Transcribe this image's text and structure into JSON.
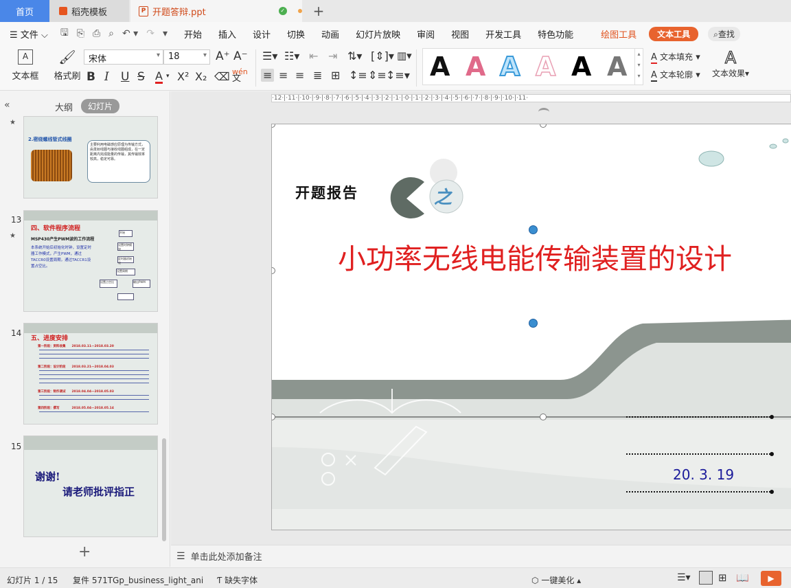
{
  "tabs": {
    "home": "首页",
    "template": "稻壳模板",
    "document": "开题答辩.ppt",
    "add": "+"
  },
  "menu": {
    "file": "文件",
    "items": [
      "开始",
      "插入",
      "设计",
      "切换",
      "动画",
      "幻灯片放映",
      "审阅",
      "视图",
      "开发工具",
      "特色功能"
    ],
    "drawing_tools": "绘图工具",
    "text_tools": "文本工具",
    "search": "查找"
  },
  "ribbon": {
    "textbox": "文本框",
    "format_painter": "格式刷",
    "font": "宋体",
    "size": "18",
    "text_fill": "文本填充",
    "text_outline": "文本轮廓",
    "text_effect": "文本效果",
    "gallery_letter": "A"
  },
  "panel": {
    "outline_tab": "大纲",
    "slides_tab": "幻灯片",
    "add_slide": "+"
  },
  "thumbs": {
    "t12": {
      "heading": "2.密绕螺线管式线圈",
      "body": "主要利用电磁感应原理为传输方式，由发射线圈与接收线圈组成，在一定距离内完成能量的传输，其传输效率较高，稳定可靠。"
    },
    "t13": {
      "num": "13",
      "title": "四、软件程序流程",
      "subtitle": "MSP430产生PWM波的工作流程",
      "body": "本系统开始后初始化时钟，设置定时器工作模式，产生PWM，通过TACCR0设置周期，通过TACCR1设置占空比。",
      "boxes": [
        "开始",
        "设置时钟模块",
        "定时器初始化",
        "设置周期",
        "设置占空比",
        "输出PWM"
      ]
    },
    "t14": {
      "num": "14",
      "title": "五、进度安排",
      "rows": [
        "第一阶段：资料收集　　2018.03.11—2018.03.20",
        "第二阶段：设计阶段　　2018.03.21—2018.04.03",
        "第三阶段：制作调试　　2018.04.04—2018.05.03",
        "第四阶段：撰写　　　　2018.05.04—2018.05.14"
      ]
    },
    "t15": {
      "num": "15",
      "line1": "谢谢!",
      "line2": "请老师批评指正"
    }
  },
  "slide": {
    "report_label": "开题报告",
    "zhi": "之",
    "title": "小功率无线电能传输装置的设计",
    "date": "20. 3. 19"
  },
  "ruler_text": "·12·|·11·|·10·|·9·|·8·|·7·|·6·|·5·|·4·|·3·|·2·|·1·|·0·|·1·|·2·|·3·|·4·|·5·|·6·|·7·|·8·|·9·|·10·|·11·",
  "notes": "单击此处添加备注",
  "status": {
    "slide_pos": "幻灯片 1 / 15",
    "template": "复件 571TGp_business_light_ani",
    "missing_font": "缺失字体",
    "beautify": "一键美化"
  },
  "colors": {
    "accent": "#e8632e",
    "home_tab": "#4a87e8",
    "title_red": "#e02020",
    "date_blue": "#1a1a9a"
  }
}
